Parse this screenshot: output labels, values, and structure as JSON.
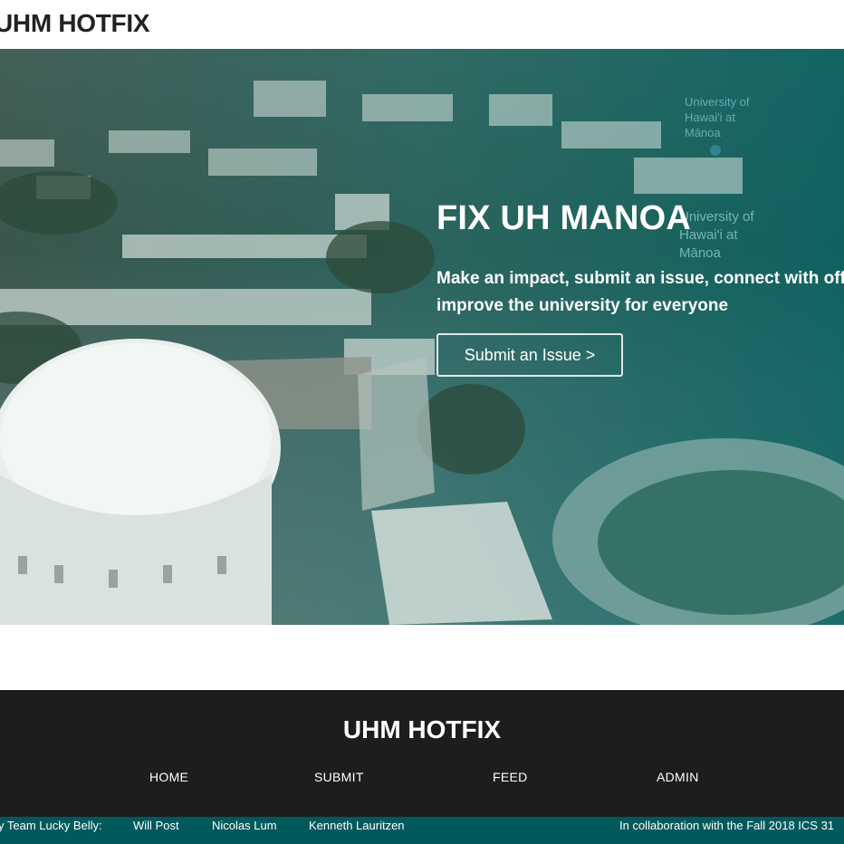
{
  "header": {
    "brand": "UHM HOTFIX"
  },
  "hero": {
    "title": "FIX UH MANOA",
    "subtitle_line1": "Make an impact, submit an issue, connect with offic",
    "subtitle_line2": "improve the university for everyone",
    "cta_label": "Submit an Issue >",
    "map_label_1": "University of Hawai'i at Mānoa",
    "map_label_2": "University of Hawai'i at Mānoa"
  },
  "footer": {
    "brand": "UHM HOTFIX",
    "nav": [
      "HOME",
      "SUBMIT",
      "FEED",
      "ADMIN"
    ],
    "credits_prefix": "y Team Lucky Belly:",
    "members": [
      "Will Post",
      "Nicolas Lum",
      "Kenneth Lauritzen"
    ],
    "collab": "In collaboration with the Fall 2018 ICS 31"
  },
  "colors": {
    "hero_overlay": "#0a6a6a",
    "footer_bg": "#1c1d1f",
    "credits_bg": "#02595c"
  }
}
